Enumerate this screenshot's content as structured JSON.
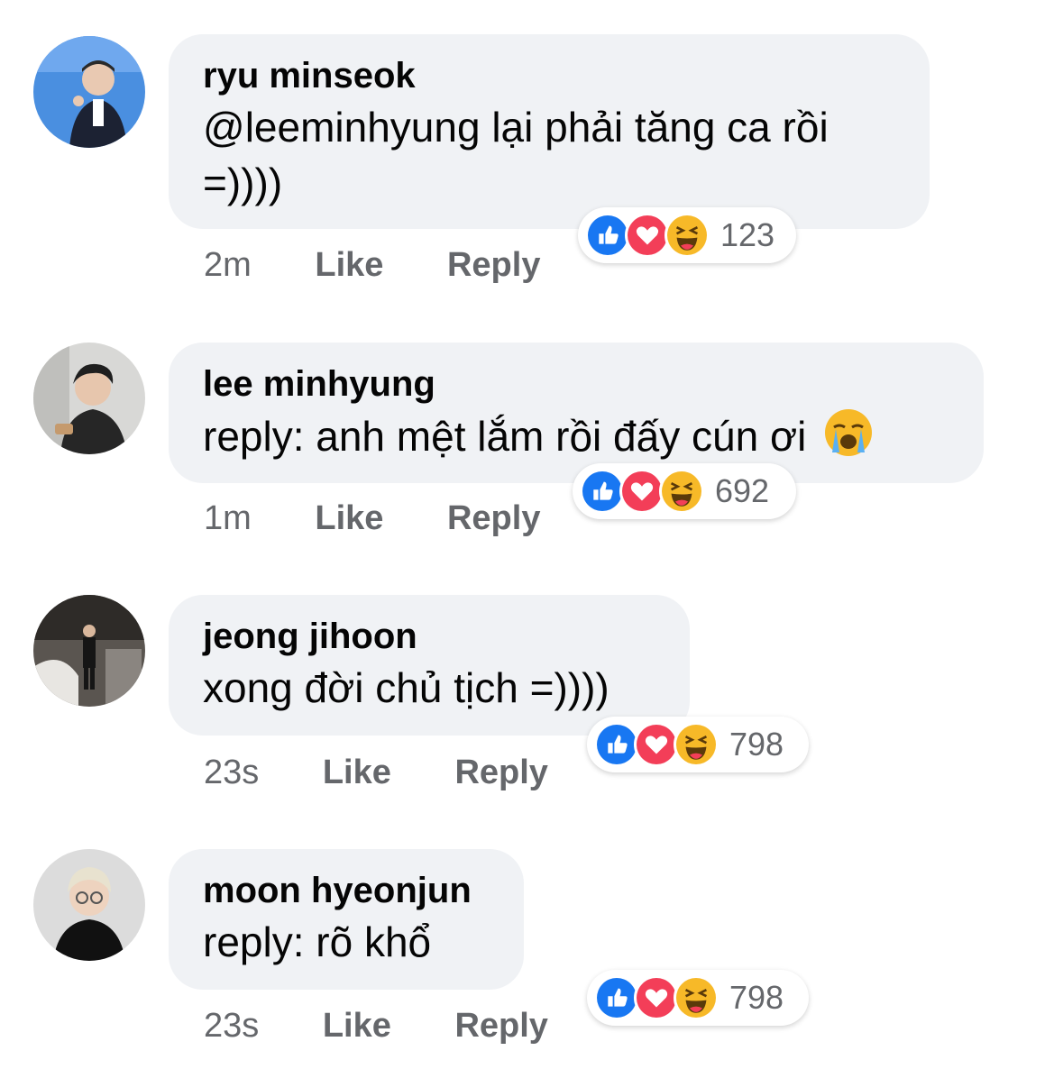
{
  "comments": [
    {
      "author": "ryu minseok",
      "text": "@leeminhyung lại phải tăng ca rồi =))))",
      "time": "2m",
      "like_label": "Like",
      "reply_label": "Reply",
      "reaction_count": "123"
    },
    {
      "author": "lee minhyung",
      "text": "reply: anh mệt lắm rồi đấy cún ơi",
      "time": "1m",
      "like_label": "Like",
      "reply_label": "Reply",
      "reaction_count": "692",
      "trailing_emoji": "crying-face"
    },
    {
      "author": "jeong jihoon",
      "text": "xong đời chủ tịch =))))",
      "time": "23s",
      "like_label": "Like",
      "reply_label": "Reply",
      "reaction_count": "798"
    },
    {
      "author": "moon hyeonjun",
      "text": "reply: rõ khổ",
      "time": "23s",
      "like_label": "Like",
      "reply_label": "Reply",
      "reaction_count": "798"
    }
  ],
  "reaction_icons": [
    "like-icon",
    "love-icon",
    "haha-icon"
  ],
  "colors": {
    "bubble_bg": "#f0f2f5",
    "like_blue": "#1877f2",
    "love_red": "#f33e58",
    "haha_yellow": "#f7b928",
    "meta_gray": "#65676b"
  }
}
